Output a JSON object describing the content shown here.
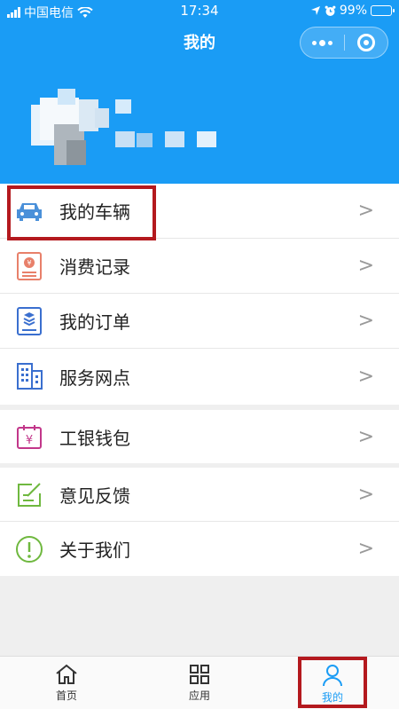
{
  "status_bar": {
    "carrier": "中国电信",
    "time": "17:34",
    "battery": "99%"
  },
  "page": {
    "title": "我的"
  },
  "menu": {
    "group1": [
      {
        "label": "我的车辆",
        "icon": "car-icon",
        "chevron": ">"
      },
      {
        "label": "消费记录",
        "icon": "receipt-icon",
        "chevron": ">"
      },
      {
        "label": "我的订单",
        "icon": "order-list-icon",
        "chevron": ">"
      },
      {
        "label": "服务网点",
        "icon": "building-icon",
        "chevron": ">"
      }
    ],
    "group2": [
      {
        "label": "工银钱包",
        "icon": "wallet-calendar-icon",
        "chevron": ">"
      }
    ],
    "group3": [
      {
        "label": "意见反馈",
        "icon": "feedback-edit-icon",
        "chevron": ">"
      },
      {
        "label": "关于我们",
        "icon": "info-exclamation-icon",
        "chevron": ">"
      }
    ]
  },
  "tabbar": [
    {
      "label": "首页",
      "icon": "home-icon"
    },
    {
      "label": "应用",
      "icon": "apps-grid-icon"
    },
    {
      "label": "我的",
      "icon": "user-icon",
      "active": true
    }
  ],
  "colors": {
    "header_bg": "#1a9cf5",
    "accent": "#1a9cf5",
    "highlight": "#b4191e"
  }
}
